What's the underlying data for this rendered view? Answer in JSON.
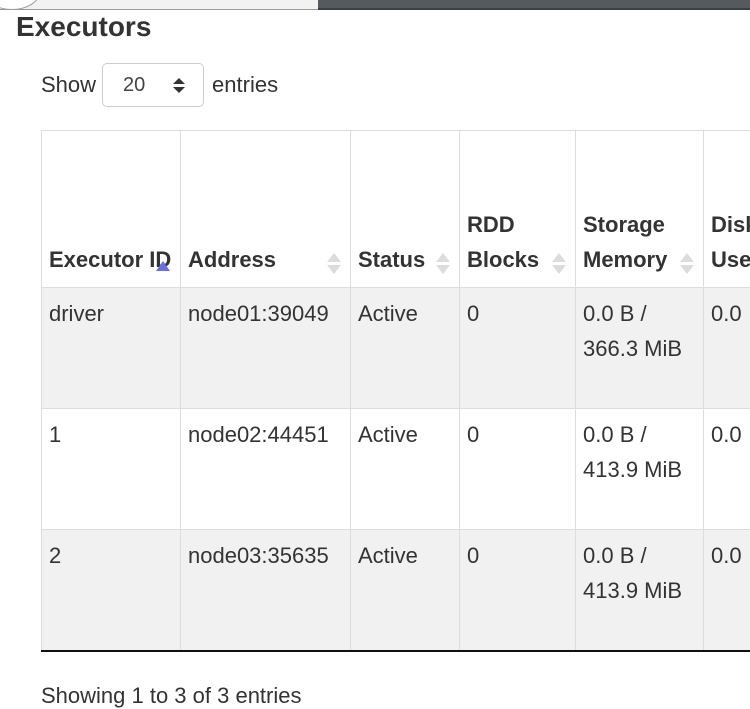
{
  "page": {
    "heading": "Executors"
  },
  "length_menu": {
    "show_label": "Show",
    "value": "20",
    "entries_label": "entries"
  },
  "table": {
    "columns": [
      {
        "label": "Executor ID",
        "sort": "asc"
      },
      {
        "label": "Address",
        "sort": "none"
      },
      {
        "label": "Status",
        "sort": "none"
      },
      {
        "label": "RDD Blocks",
        "sort": "none"
      },
      {
        "label": "Storage Memory",
        "sort": "none"
      },
      {
        "label": "Disk Used",
        "sort": "none"
      }
    ],
    "rows": [
      {
        "id": "driver",
        "address": "node01:39049",
        "status": "Active",
        "rdd_blocks": "0",
        "storage_memory": "0.0 B / 366.3 MiB",
        "disk_used": "0.0"
      },
      {
        "id": "1",
        "address": "node02:44451",
        "status": "Active",
        "rdd_blocks": "0",
        "storage_memory": "0.0 B / 413.9 MiB",
        "disk_used": "0.0"
      },
      {
        "id": "2",
        "address": "node03:35635",
        "status": "Active",
        "rdd_blocks": "0",
        "storage_memory": "0.0 B / 413.9 MiB",
        "disk_used": "0.0"
      }
    ]
  },
  "footer": {
    "info": "Showing 1 to 3 of 3 entries"
  },
  "colors": {
    "sort_active": "#6b6fdb",
    "sort_inactive": "#dcdcdc",
    "row_odd": "#f1f1f1",
    "topbar_dark": "#555a5e"
  },
  "icons": {
    "sort_asc": "sort-ascending-icon",
    "sort_both": "sort-both-icon",
    "stepper": "up-down-stepper-icon"
  }
}
